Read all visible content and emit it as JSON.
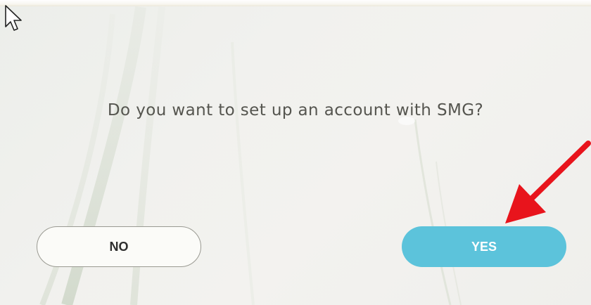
{
  "dialog": {
    "question": "Do you want to set up an account with SMG?",
    "no_label": "NO",
    "yes_label": "YES"
  },
  "colors": {
    "yes_button": "#5cc3db",
    "annotation_arrow": "#e8141c",
    "question_text": "#55554f"
  },
  "icons": {
    "cursor": "mouse-pointer-icon",
    "annotation": "red-arrow-icon"
  }
}
